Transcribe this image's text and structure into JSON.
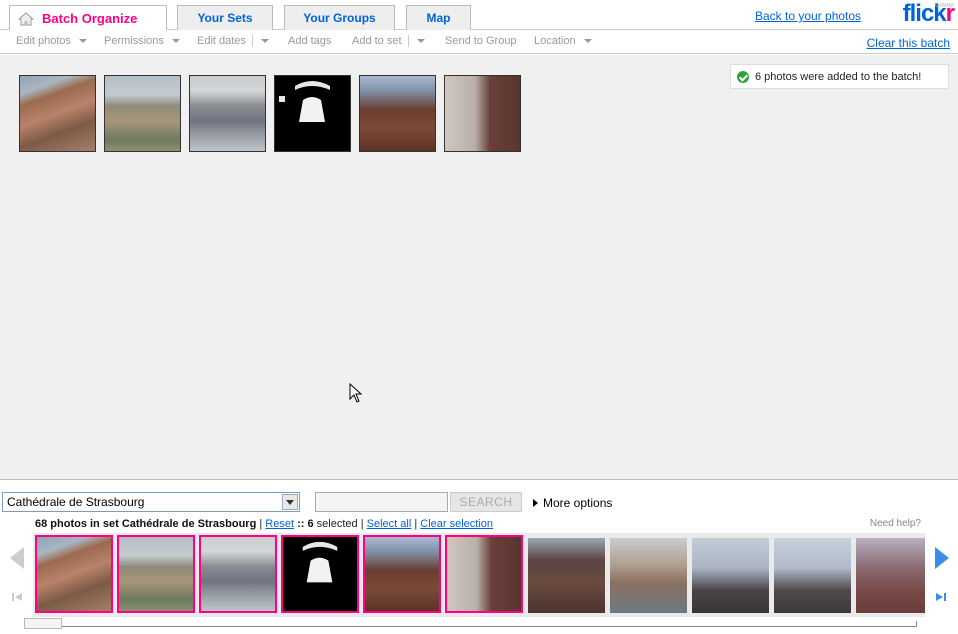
{
  "tabs": [
    {
      "label": "Batch Organize",
      "active": true
    },
    {
      "label": "Your Sets",
      "active": false
    },
    {
      "label": "Your Groups",
      "active": false
    },
    {
      "label": "Map",
      "active": false
    }
  ],
  "header": {
    "back_link": "Back to your photos",
    "logo_flick": "flick",
    "logo_r": "r",
    "logo_badge": "GAMMA"
  },
  "toolbar": {
    "edit_photos": "Edit photos",
    "permissions": "Permissions",
    "edit_dates": "Edit dates",
    "add_tags": "Add tags",
    "add_to_set": "Add to set",
    "send_to_group": "Send to Group",
    "location": "Location",
    "clear_batch": "Clear this batch"
  },
  "batch": {
    "notice": "6 photos were added to the batch!",
    "photo_count": 6
  },
  "tray": {
    "set_select": "Cathédrale de Strasbourg",
    "search_placeholder": "",
    "search_button": "SEARCH",
    "more_options": "More options",
    "count_text": "68 photos in set",
    "set_name": "Cathédrale de Strasbourg",
    "sep1": "|",
    "reset": "Reset",
    "selected_prefix": "::",
    "selected_count": "6",
    "selected_suffix": "selected",
    "sep2": "|",
    "select_all": "Select all",
    "sep3": "|",
    "clear_selection": "Clear selection",
    "need_help": "Need help?"
  },
  "colors": {
    "brand_blue": "#0063dc",
    "brand_pink": "#ff0084",
    "success": "#2ea33a"
  }
}
